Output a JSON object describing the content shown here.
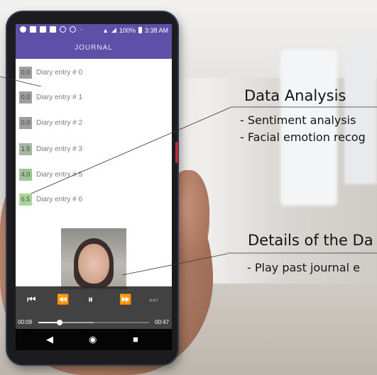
{
  "status_bar": {
    "battery": "100%",
    "time": "3:38 AM"
  },
  "app_bar": {
    "title": "JOURNAL"
  },
  "entries": [
    {
      "score": "0.0",
      "label": "Diary entry # 0",
      "color": "#9e9e9e"
    },
    {
      "score": "0.0",
      "label": "Diary entry # 1",
      "color": "#9e9e9e"
    },
    {
      "score": "0.0",
      "label": "Diary entry # 2",
      "color": "#9e9e9e"
    },
    {
      "score": "1.5",
      "label": "Diary entry # 3",
      "color": "#a5b79f"
    },
    {
      "score": "4.0",
      "label": "Diary entry # 5",
      "color": "#9fc495"
    },
    {
      "score": "6.5",
      "label": "Diary entry # 6",
      "color": "#a8d79a"
    }
  ],
  "player": {
    "elapsed": "00:09",
    "total": "00:47",
    "progress": 0.19,
    "buffered": 0.5
  },
  "callouts": {
    "data_analysis": {
      "title": "Data Analysis",
      "items": [
        "- Sentiment analysis",
        "- Facial emotion recog"
      ]
    },
    "details": {
      "title": "Details of the Da",
      "items": [
        "- Play past journal e"
      ]
    }
  },
  "colors": {
    "accent": "#5e4fa8",
    "player_bg": "#282828"
  }
}
